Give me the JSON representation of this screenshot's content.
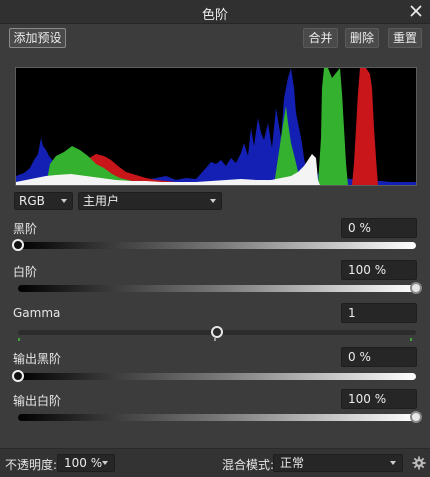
{
  "window": {
    "title": "色阶"
  },
  "toolbar": {
    "add_preset": "添加预设",
    "merge": "合并",
    "delete": "删除",
    "reset": "重置"
  },
  "channel": {
    "selected": "RGB"
  },
  "profile": {
    "selected": "主用户"
  },
  "sliders": {
    "black": {
      "label": "黑阶",
      "value_text": "0 %",
      "value": 0
    },
    "white": {
      "label": "白阶",
      "value_text": "100 %",
      "value": 100
    },
    "gamma": {
      "label": "Gamma",
      "value_text": "1",
      "value": 1
    },
    "out_black": {
      "label": "输出黑阶",
      "value_text": "0 %",
      "value": 0
    },
    "out_white": {
      "label": "输出白阶",
      "value_text": "100 %",
      "value": 100
    }
  },
  "bottom": {
    "opacity_label": "不透明度:",
    "opacity_value": "100 %",
    "blend_label": "混合模式:",
    "blend_value": "正常"
  },
  "icons": {
    "close": "close-icon",
    "settings": "gear-icon"
  },
  "colors": {
    "red": "#c8161b",
    "green": "#33b12f",
    "blue": "#1420b4",
    "luma": "#ffffff"
  }
}
